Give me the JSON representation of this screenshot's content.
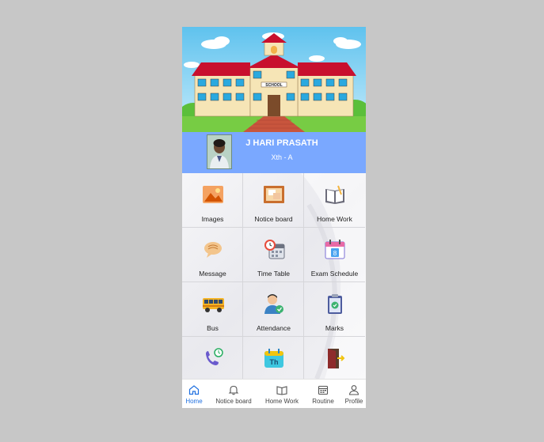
{
  "student": {
    "name": "J HARI PRASATH",
    "class": "Xth - A"
  },
  "banner": {
    "sign_text": "SCHOOL"
  },
  "menu": {
    "items": [
      {
        "label": "Images",
        "icon": "image-icon"
      },
      {
        "label": "Notice board",
        "icon": "notice-board-icon"
      },
      {
        "label": "Home Work",
        "icon": "homework-book-icon"
      },
      {
        "label": "Message",
        "icon": "message-icon"
      },
      {
        "label": "Time Table",
        "icon": "clock-calendar-icon"
      },
      {
        "label": "Exam Schedule",
        "icon": "calendar-icon"
      },
      {
        "label": "Bus",
        "icon": "bus-icon"
      },
      {
        "label": "Attendance",
        "icon": "attendance-icon"
      },
      {
        "label": "Marks",
        "icon": "clipboard-check-icon"
      },
      {
        "label": "",
        "icon": "phone-call-icon"
      },
      {
        "label": "",
        "icon": "thursday-calendar-icon"
      },
      {
        "label": "",
        "icon": "logout-door-icon"
      }
    ],
    "thursday_text": "Th"
  },
  "bottom_nav": {
    "items": [
      {
        "label": "Home",
        "icon": "home-icon",
        "active": true
      },
      {
        "label": "Notice board",
        "icon": "bell-icon",
        "active": false
      },
      {
        "label": "Home Work",
        "icon": "book-icon",
        "active": false
      },
      {
        "label": "Routine",
        "icon": "calendar-grid-icon",
        "active": false
      },
      {
        "label": "Profile",
        "icon": "person-icon",
        "active": false
      }
    ]
  },
  "colors": {
    "profile_bar": "#7aa8ff",
    "active_nav": "#1e6fe0",
    "roof": "#c8102e"
  }
}
